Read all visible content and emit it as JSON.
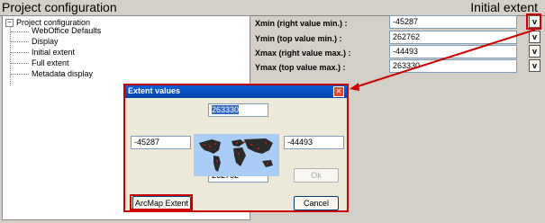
{
  "header": {
    "left_title": "Project configuration",
    "right_title": "Initial extent"
  },
  "tree": {
    "root_label": "Project configuration",
    "expand_glyph": "−",
    "children": [
      "WebOffice Defaults",
      "Display",
      "Initial extent",
      "Full extent",
      "Metadata display"
    ]
  },
  "fields": [
    {
      "label": "Xmin (right value min.) :",
      "value": "-45287",
      "button": "v"
    },
    {
      "label": "Ymin (top value min.) :",
      "value": "262762",
      "button": "v"
    },
    {
      "label": "Xmax (right value max.) :",
      "value": "-44493",
      "button": "v"
    },
    {
      "label": "Ymax (top value max.) :",
      "value": "263330",
      "button": "v"
    }
  ],
  "dialog": {
    "title": "Extent values",
    "close_glyph": "✕",
    "top_value": "263330",
    "left_value": "-45287",
    "right_value": "-44493",
    "bottom_value": "262762",
    "ok_label": "Ok",
    "arcmap_label": "ArcMap Extent",
    "cancel_label": "Cancel"
  },
  "colors": {
    "highlight": "#cc0000",
    "titlebar": "#0a5fd6",
    "selection": "#316ac5"
  }
}
